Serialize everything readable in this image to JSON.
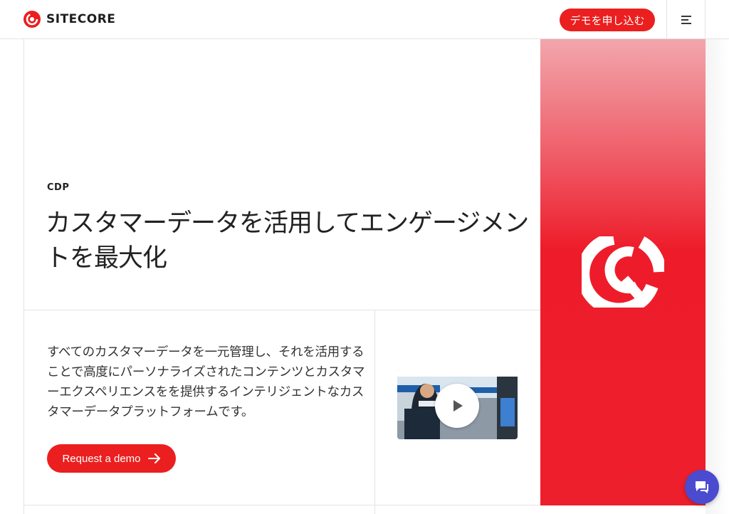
{
  "header": {
    "brand": "SITECORE",
    "demo_button": "デモを申し込む"
  },
  "hero": {
    "eyebrow": "CDP",
    "headline": "カスタマーデータを活用してエンゲージメントを最大化",
    "description": "すべてのカスタマーデータを一元管理し、それを活用することで高度にパーソナライズされたコンテンツとカスタマーエクスペリエンスをを提供するインテリジェントなカスタマーデータプラットフォームです。",
    "cta_label": "Request a demo"
  },
  "colors": {
    "brand_red": "#eb1f1f",
    "chat_button": "#4b4bd0"
  },
  "icons": {
    "menu": "hamburger-menu-icon",
    "cta_arrow": "arrow-right-icon",
    "play": "play-icon",
    "chat": "chat-icon"
  }
}
